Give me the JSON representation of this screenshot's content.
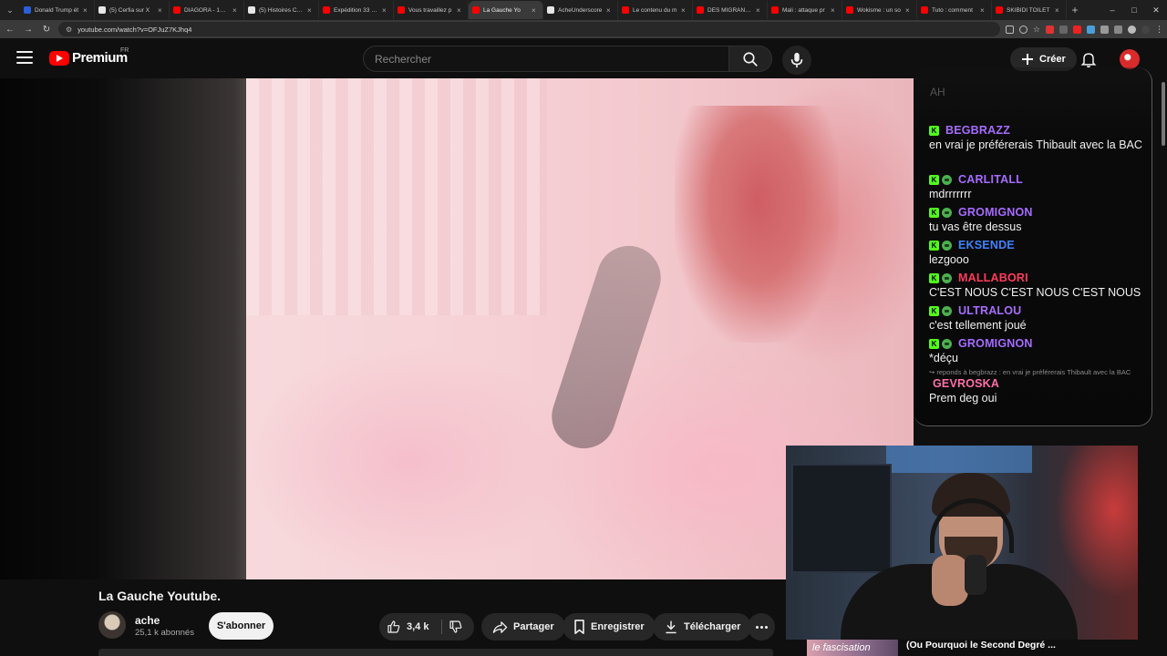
{
  "browser": {
    "tabs": [
      {
        "title": "Donald Trump ét",
        "color": "#2b5fd9",
        "active": false
      },
      {
        "title": "(5) Cerfia sur X",
        "color": "#e7e7e7",
        "active": false
      },
      {
        "title": "DIAGORA - 17 ar",
        "color": "#ff0000",
        "active": false
      },
      {
        "title": "(5) Histoires Crép",
        "color": "#e7e7e7",
        "active": false
      },
      {
        "title": "Expédition 33 : P",
        "color": "#ff0000",
        "active": false
      },
      {
        "title": "Vous travaillez p",
        "color": "#ff0000",
        "active": false
      },
      {
        "title": "La Gauche Yo",
        "color": "#ff0000",
        "active": true
      },
      {
        "title": "AcheUnderscore",
        "color": "#e7e7e7",
        "active": false
      },
      {
        "title": "Le contenu du m",
        "color": "#ff0000",
        "active": false
      },
      {
        "title": "DES MIGRANTS",
        "color": "#ff0000",
        "active": false
      },
      {
        "title": "Mali : attaque pr",
        "color": "#ff0000",
        "active": false
      },
      {
        "title": "Wokisme : un so",
        "color": "#ff0000",
        "active": false
      },
      {
        "title": "Tuto : comment",
        "color": "#ff0000",
        "active": false
      },
      {
        "title": "SKIBIDI TOILET",
        "color": "#ff0000",
        "active": false
      }
    ],
    "url": "youtube.com/watch?v=OFJuZ7KJhq4",
    "window_controls": [
      "–",
      "□",
      "✕"
    ]
  },
  "header": {
    "logo_text": "Premium",
    "logo_region": "FR",
    "search_placeholder": "Rechercher",
    "create_label": "Créer"
  },
  "chat": {
    "faded_top": "AH",
    "messages": [
      {
        "user": "BEGBRAZZ",
        "color": "#a66cff",
        "text": "en vrai je préférerais Thibault avec la BAC",
        "badges": [
          "k"
        ]
      },
      {
        "user": "CARLITALL",
        "color": "#a66cff",
        "text": "mdrrrrrrr",
        "badges": [
          "k",
          "a"
        ]
      },
      {
        "user": "GROMIGNON",
        "color": "#a66cff",
        "text": "tu vas être dessus",
        "badges": [
          "k",
          "a"
        ]
      },
      {
        "user": "EKSENDE",
        "color": "#3f82ff",
        "text": "lezgooo",
        "badges": [
          "k",
          "a"
        ]
      },
      {
        "user": "MALLABORI",
        "color": "#ff3b5c",
        "text": "C'EST NOUS C'EST NOUS C'EST NOUS",
        "badges": [
          "k",
          "a"
        ]
      },
      {
        "user": "ULTRALOU",
        "color": "#a66cff",
        "text": "c'est tellement joué",
        "badges": [
          "k",
          "a"
        ]
      },
      {
        "user": "GROMIGNON",
        "color": "#a66cff",
        "text": "*déçu",
        "badges": [
          "k",
          "a"
        ]
      },
      {
        "user": "GEVROSKA",
        "color": "#ff6fa8",
        "text": "Prem deg oui",
        "badges": [],
        "reply": "↪ reponds à begbrazz : en vrai je préférerais Thibault avec la BAC"
      }
    ]
  },
  "webcam": {
    "caption_thumb": "le fascisation",
    "caption_text": "(Ou Pourquoi le Second Degré ..."
  },
  "video": {
    "title": "La Gauche Youtube.",
    "channel": "ache",
    "subscribers": "25,1 k abonnés",
    "subscribe_label": "S'abonner",
    "likes": "3,4 k",
    "share_label": "Partager",
    "save_label": "Enregistrer",
    "download_label": "Télécharger"
  }
}
